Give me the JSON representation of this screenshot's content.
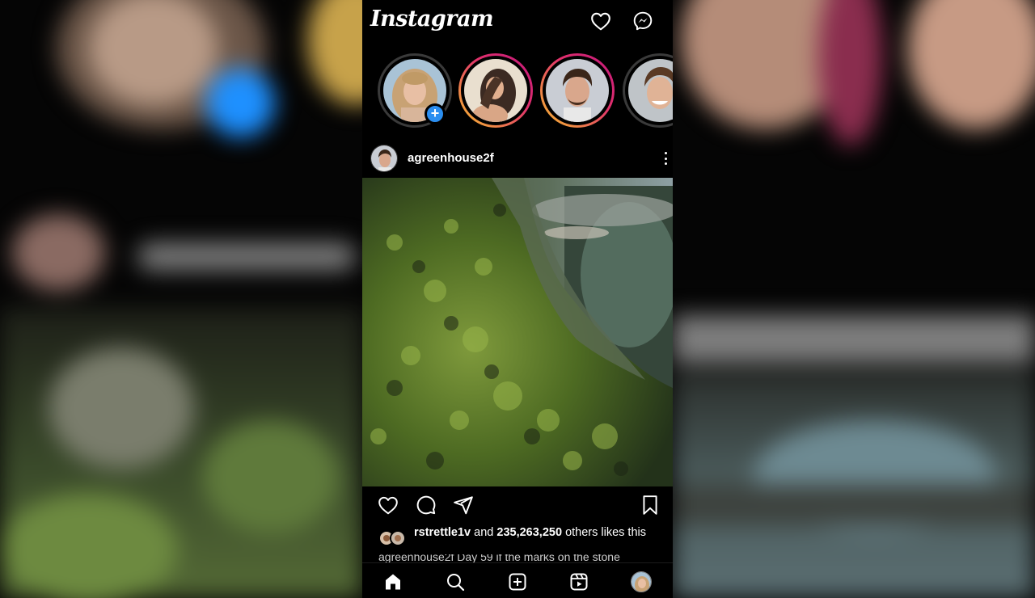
{
  "app": {
    "logo_text": "Instagram"
  },
  "header": {
    "icons": [
      "heart-icon",
      "messenger-icon"
    ]
  },
  "stories": [
    {
      "name": "your-story",
      "has_add_badge": true,
      "ring": "none"
    },
    {
      "name": "story-2",
      "ring": "gradient"
    },
    {
      "name": "story-3",
      "ring": "gradient"
    },
    {
      "name": "story-4",
      "ring": "seen"
    }
  ],
  "add_badge_glyph": "+",
  "post": {
    "username": "agreenhouse2f",
    "more_icon": "more-vertical-icon",
    "likes": {
      "first_liker": "rstrettle1v",
      "connector": "and",
      "count": "235,263,250",
      "suffix": "others likes this"
    },
    "caption": "agreenhouse2f Day 59 if the marks on the stone"
  },
  "actions": [
    "heart-icon",
    "comment-icon",
    "share-icon",
    "bookmark-icon"
  ],
  "nav": [
    "home-icon",
    "search-icon",
    "add-post-icon",
    "reels-icon",
    "profile-avatar"
  ],
  "colors": {
    "background": "#000000",
    "badge_blue": "#2b8ef0",
    "story_gradient_start": "#f8c12e",
    "story_gradient_end": "#c1167d"
  }
}
